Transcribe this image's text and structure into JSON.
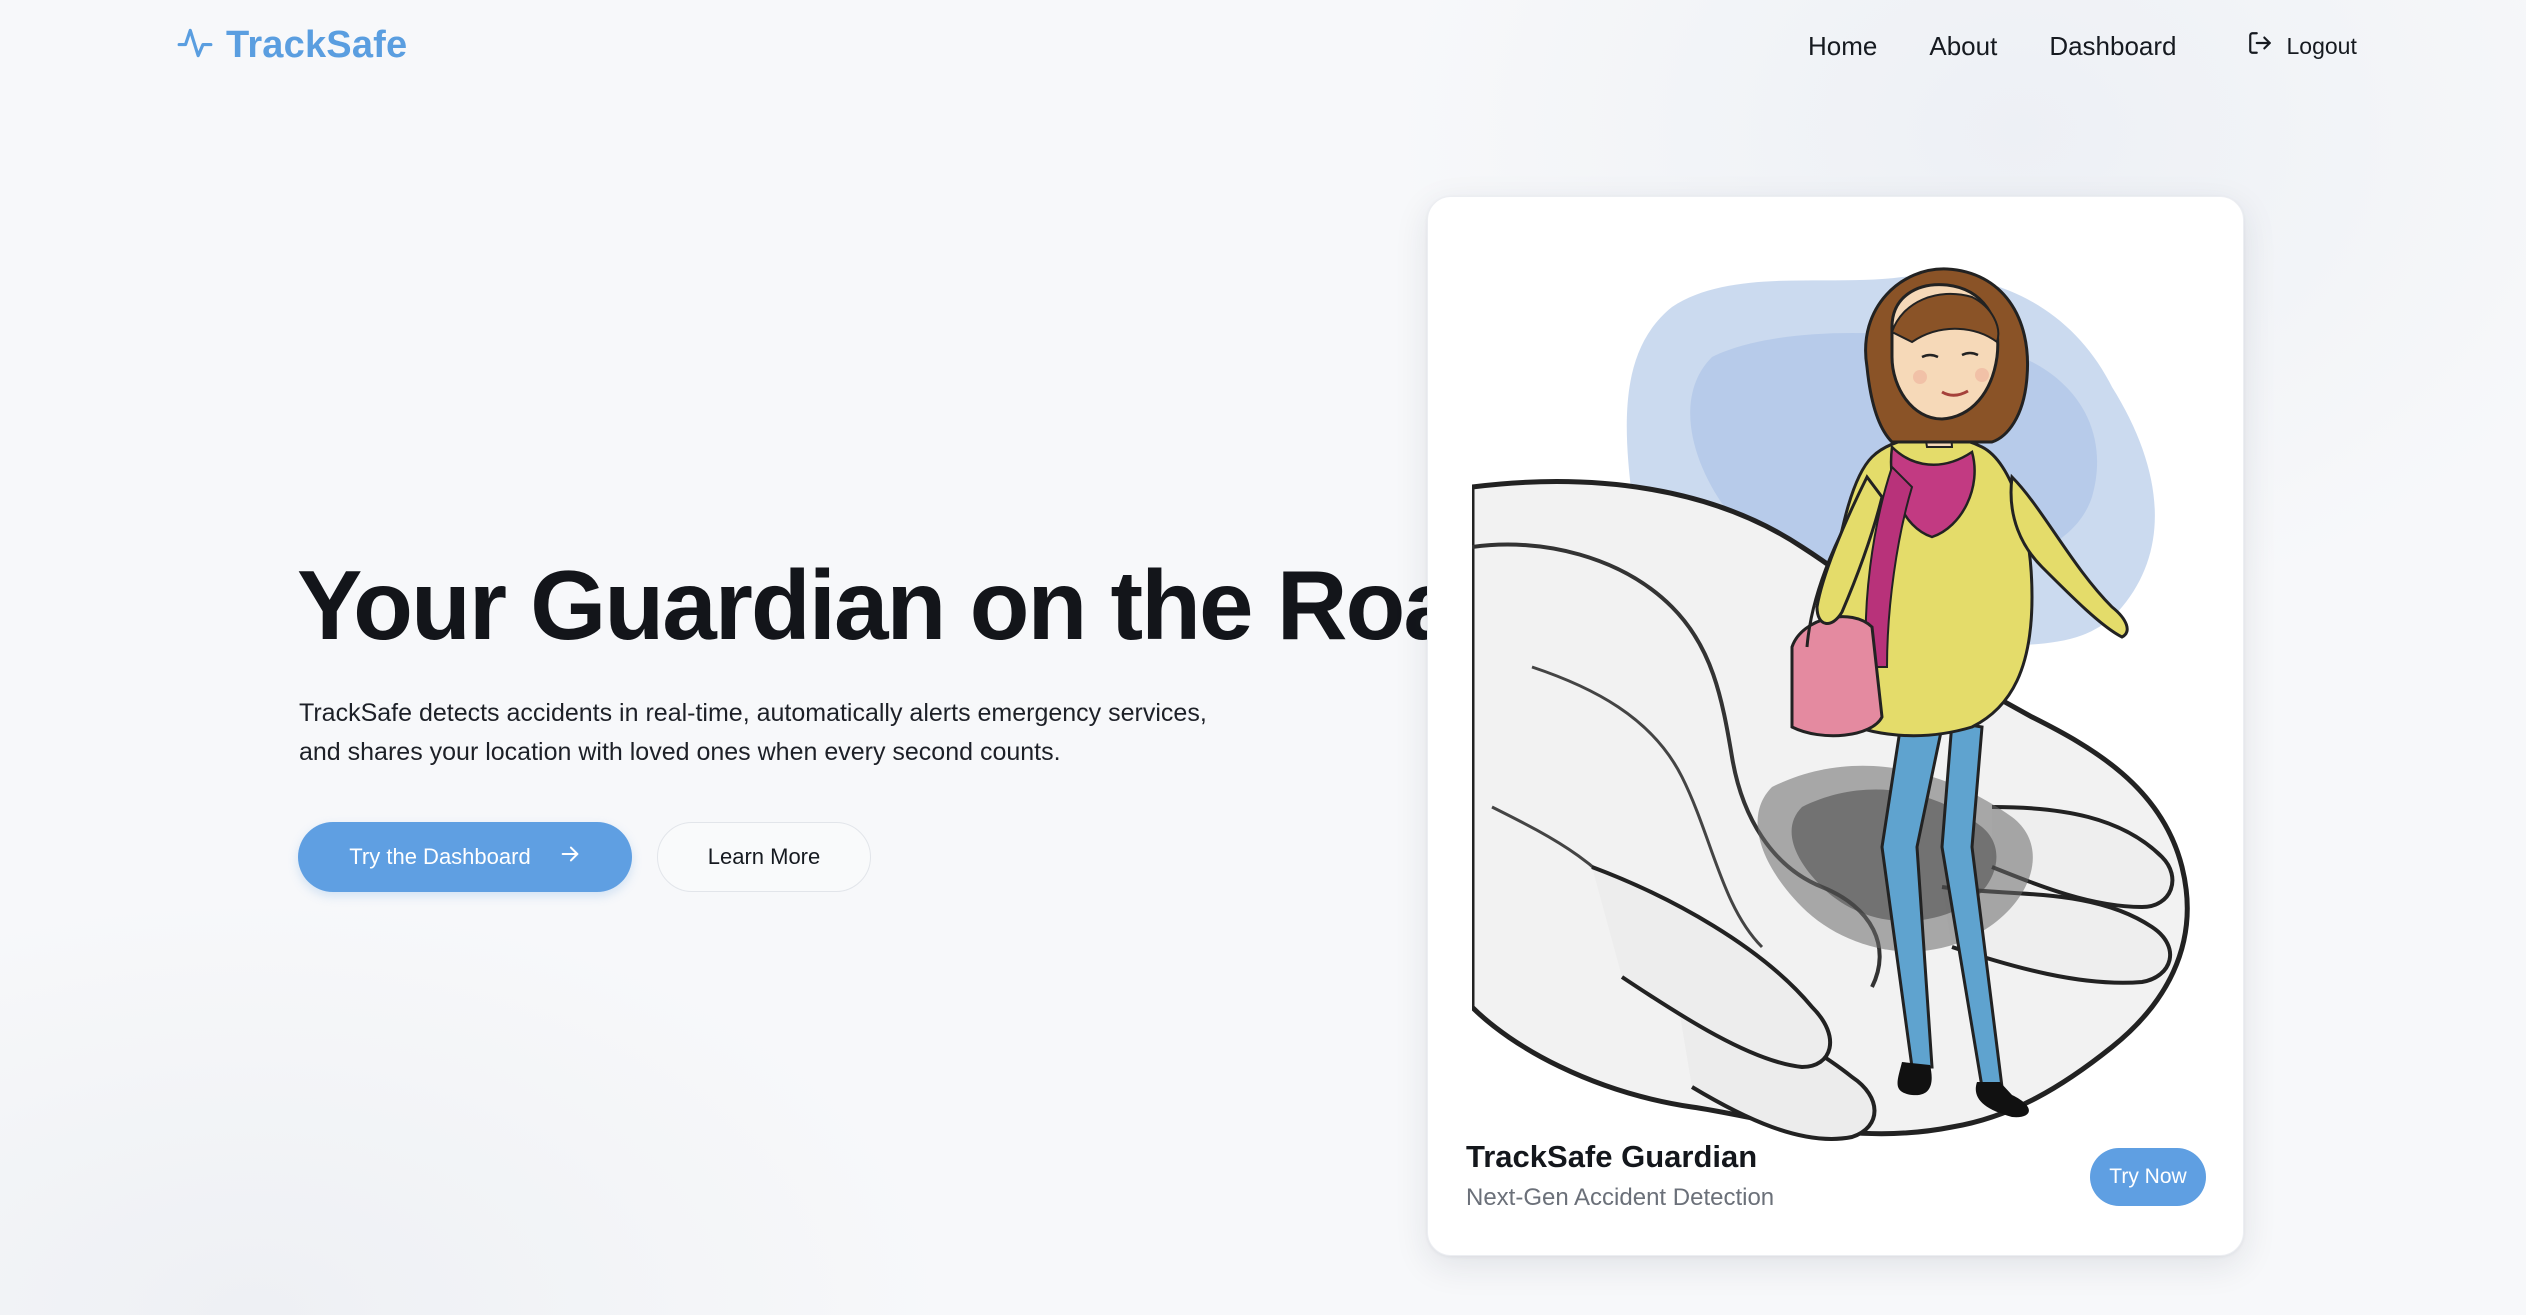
{
  "brand": {
    "name": "TrackSafe",
    "icon": "pulse-icon",
    "color": "#5a9ee0"
  },
  "nav": {
    "items": [
      {
        "label": "Home"
      },
      {
        "label": "About"
      },
      {
        "label": "Dashboard"
      }
    ],
    "logout": {
      "label": "Logout",
      "icon": "logout-icon"
    }
  },
  "hero": {
    "title": "Your Guardian on the Road",
    "description_line1": "TrackSafe detects accidents in real-time, automatically alerts emergency services,",
    "description_line2": "and shares your location with loved ones when every second counts.",
    "primary_button": {
      "label": "Try the Dashboard",
      "icon": "arrow-right-icon"
    },
    "secondary_button": {
      "label": "Learn More"
    }
  },
  "card": {
    "image": "woman-on-hand-illustration",
    "title": "TrackSafe Guardian",
    "subtitle": "Next-Gen Accident Detection",
    "button": {
      "label": "Try Now"
    }
  },
  "colors": {
    "accent": "#5f9fe2",
    "background": "#f7f8fa",
    "text": "#13151a"
  }
}
